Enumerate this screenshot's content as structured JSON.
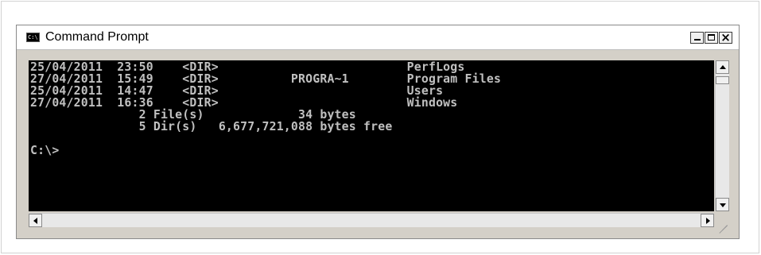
{
  "window": {
    "title": "Command Prompt",
    "icon": "cmd-icon",
    "icon_label": "C:\\"
  },
  "console": {
    "lines": [
      "25/04/2011  23:50    <DIR>                          PerfLogs",
      "27/04/2011  15:49    <DIR>          PROGRA~1        Program Files",
      "25/04/2011  14:47    <DIR>                          Users",
      "27/04/2011  16:36    <DIR>                          Windows",
      "               2 File(s)             34 bytes",
      "               5 Dir(s)   6,677,721,088 bytes free",
      "",
      "C:\\>"
    ]
  },
  "colors": {
    "console_background": "#000000",
    "console_text": "#c0c0c0"
  },
  "icons": {
    "minimize": "minimize-icon",
    "maximize": "maximize-icon",
    "close": "close-icon",
    "scroll_up": "arrow-up-icon",
    "scroll_down": "arrow-down-icon",
    "scroll_left": "arrow-left-icon",
    "scroll_right": "arrow-right-icon",
    "resize_grip": "resize-grip-icon"
  }
}
